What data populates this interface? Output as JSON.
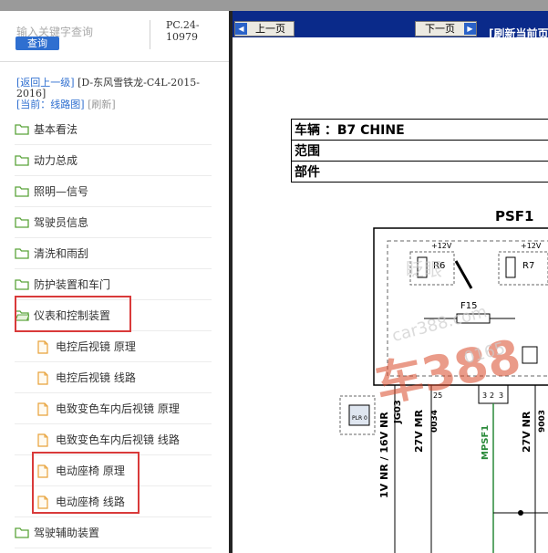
{
  "search": {
    "placeholder": "输入关键字查询",
    "button_label": "查询"
  },
  "pc_code": "PC.24-10979",
  "breadcrumb": {
    "back_link": "[返回上一级]",
    "path": "[D-东风雪铁龙-C4L-2015-2016]",
    "current_label": "[当前：线路图]",
    "refresh_label": "[刷新]"
  },
  "tree": [
    {
      "label": "基本看法",
      "type": "folder",
      "open": false
    },
    {
      "label": "动力总成",
      "type": "folder",
      "open": false
    },
    {
      "label": "照明—信号",
      "type": "folder",
      "open": false
    },
    {
      "label": "驾驶员信息",
      "type": "folder",
      "open": false
    },
    {
      "label": "清洗和雨刮",
      "type": "folder",
      "open": false
    },
    {
      "label": "防护装置和车门",
      "type": "folder",
      "open": false
    },
    {
      "label": "仪表和控制装置",
      "type": "folder",
      "open": true
    },
    {
      "label": "电控后视镜 原理",
      "type": "doc"
    },
    {
      "label": "电控后视镜 线路",
      "type": "doc"
    },
    {
      "label": "电致变色车内后视镜 原理",
      "type": "doc"
    },
    {
      "label": "电致变色车内后视镜 线路",
      "type": "doc"
    },
    {
      "label": "电动座椅 原理",
      "type": "doc"
    },
    {
      "label": "电动座椅 线路",
      "type": "doc"
    },
    {
      "label": "驾驶辅助装置",
      "type": "folder",
      "open": false
    }
  ],
  "pager": {
    "prev_label": "上一页",
    "next_label": "下一页",
    "refresh_label": "[刷新当前页"
  },
  "info": {
    "vehicle": "车辆 ：B7 CHINE",
    "scope": "范围",
    "part": "部件"
  },
  "diagram": {
    "title": "PSF1",
    "supply_left": "+12V",
    "supply_right": "+12V",
    "relay_left": "R6",
    "relay_right": "R7",
    "fuse": "F15",
    "wires": [
      "1V NR / 16V NR",
      "27V MR",
      "MPSF1",
      "27V NR"
    ],
    "codes": [
      "JG03",
      "0034",
      "9003"
    ],
    "pins": [
      "3",
      "2",
      "3",
      "25"
    ],
    "connector": "PLR 0"
  },
  "watermark": [
    "眨眼",
    "car388.com",
    "车388",
    "0165"
  ],
  "colors": {
    "accent": "#2f6fd0",
    "toolbar": "#0a2a8a",
    "highlight": "#d93a3a",
    "folder": "#5aa33a",
    "doc": "#e8a23a"
  }
}
